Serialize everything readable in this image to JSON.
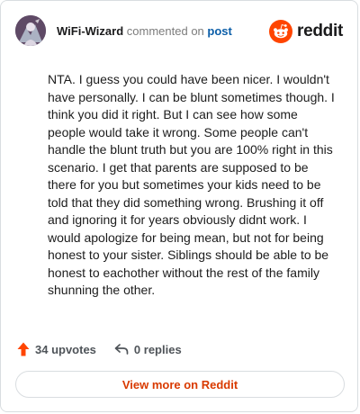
{
  "header": {
    "author": "WiFi-Wizard",
    "action_text": "commented on",
    "post_link": "post",
    "brand": "reddit"
  },
  "comment": {
    "body": "NTA. I guess you could have been nicer. I wouldn't have personally. I can be blunt sometimes though. I think you did it right. But I can see how some people would take it wrong. Some people can't handle the blunt truth but you are 100% right in this scenario. I get that parents are supposed to be there for you but sometimes your kids need to be told that they did something wrong. Brushing it off and ignoring it for years obviously didnt work. I would apologize for being mean, but not for being honest to your sister. Siblings should be able to be honest to eachother without the rest of the family shunning the other."
  },
  "actions": {
    "upvotes": "34 upvotes",
    "replies": "0 replies"
  },
  "footer": {
    "view_more": "View more on Reddit"
  },
  "colors": {
    "brand": "#ff4500",
    "link": "#0b5ea8",
    "view_more": "#d93a00"
  },
  "icons": [
    "avatar",
    "reddit-logo-icon",
    "upvote-arrow-icon",
    "reply-arrow-icon"
  ]
}
